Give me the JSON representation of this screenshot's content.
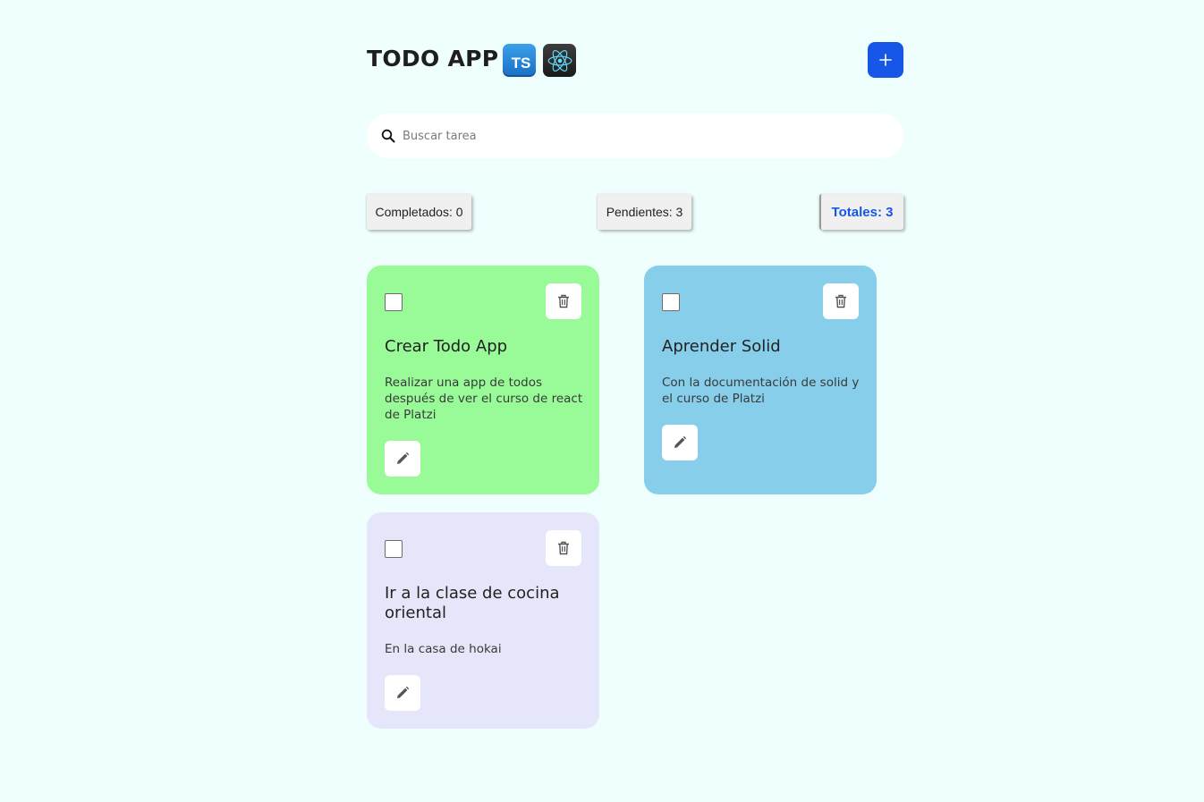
{
  "header": {
    "title": "TODO APP",
    "logos": [
      {
        "name": "typescript-logo",
        "text": "TS"
      },
      {
        "name": "react-logo",
        "icon": "react-atom"
      }
    ],
    "add_button_icon": "plus-icon"
  },
  "search": {
    "placeholder": "Buscar tarea",
    "value": ""
  },
  "counters": {
    "completed": "Completados: 0",
    "pending": "Pendientes: 3",
    "total": "Totales: 3"
  },
  "todos": [
    {
      "title": "Crear Todo App",
      "description": "Realizar una app de todos después de ver el curso de react de Platzi",
      "completed": false,
      "color": "#98fb98"
    },
    {
      "title": "Aprender Solid",
      "description": "Con la documentación de solid y el curso de Platzi",
      "completed": false,
      "color": "#87ceeb"
    },
    {
      "title": "Ir a la clase de cocina oriental",
      "description": "En la casa de hokai",
      "completed": false,
      "color": "#e6e6fa"
    }
  ],
  "colors": {
    "background": "#effffe",
    "accent": "#1657e8"
  }
}
